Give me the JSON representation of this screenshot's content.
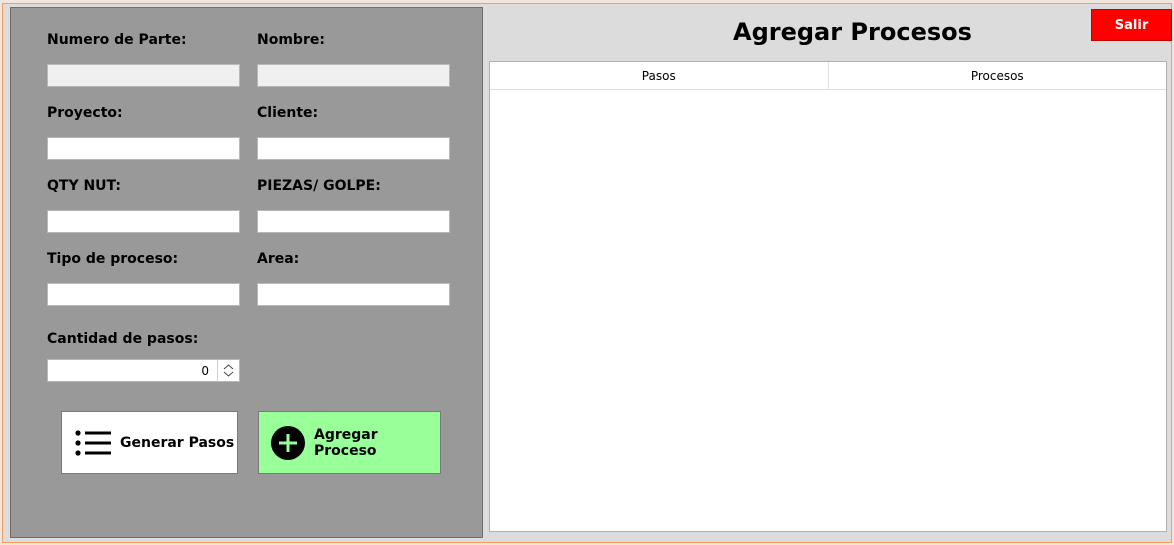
{
  "header": {
    "title": "Agregar Procesos",
    "exit_label": "Salir"
  },
  "form": {
    "numero_parte": {
      "label": "Numero de Parte:",
      "value": ""
    },
    "nombre": {
      "label": "Nombre:",
      "value": ""
    },
    "proyecto": {
      "label": "Proyecto:",
      "value": ""
    },
    "cliente": {
      "label": "Cliente:",
      "value": ""
    },
    "qty_nut": {
      "label": "QTY NUT:",
      "value": ""
    },
    "piezas_golpe": {
      "label": "PIEZAS/ GOLPE:",
      "value": ""
    },
    "tipo_proceso": {
      "label": "Tipo de proceso:",
      "value": ""
    },
    "area": {
      "label": "Area:",
      "value": ""
    },
    "cantidad_pasos": {
      "label": "Cantidad de pasos:",
      "value": "0"
    }
  },
  "buttons": {
    "generar": {
      "label": "Generar Pasos",
      "icon": "list-icon"
    },
    "agregar": {
      "label": "Agregar Proceso",
      "icon": "plus-circle-icon"
    }
  },
  "table": {
    "columns": [
      "Pasos",
      "Procesos"
    ],
    "rows": []
  },
  "colors": {
    "exit": "#ff0000",
    "add_button": "#99ff99",
    "panel": "#999999"
  }
}
